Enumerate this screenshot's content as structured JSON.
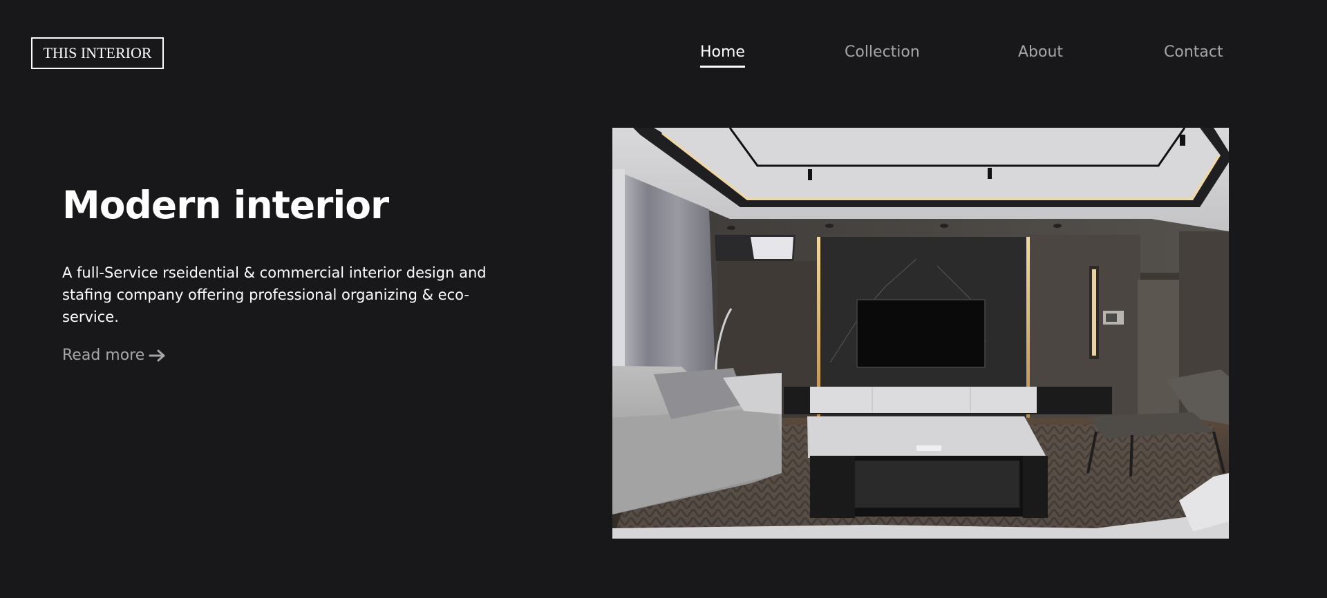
{
  "header": {
    "logo_text": "THIS INTERIOR",
    "nav": [
      {
        "label": "Home",
        "active": true
      },
      {
        "label": "Collection",
        "active": false
      },
      {
        "label": "About",
        "active": false
      },
      {
        "label": "Contact",
        "active": false
      }
    ]
  },
  "hero": {
    "title": "Modern interior",
    "description": "A full-Service rseidential & commercial interior design and stafing company offering professional organizing & eco-service.",
    "read_more_label": "Read more",
    "read_more_icon": "arrow-right-icon",
    "image_subject": "living-room-photo"
  },
  "colors": {
    "background": "#18181a",
    "text_primary": "#ffffff",
    "text_muted": "#a6a6a6"
  }
}
